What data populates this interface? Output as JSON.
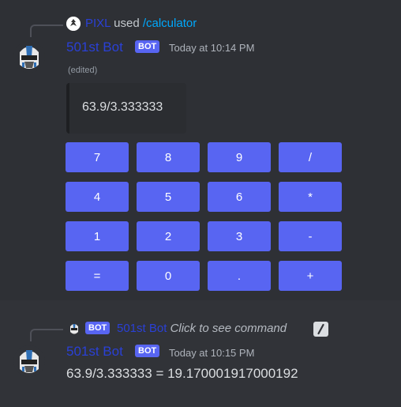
{
  "message1": {
    "reference": {
      "user": "PIXL",
      "mid_text": "used",
      "command": "/calculator"
    },
    "author": "501st Bot",
    "bot_tag": "BOT",
    "timestamp": "Today at 10:14 PM",
    "edited": "(edited)",
    "embed_text": "63.9/3.333333",
    "keypad": [
      [
        "7",
        "8",
        "9",
        "/"
      ],
      [
        "4",
        "5",
        "6",
        "*"
      ],
      [
        "1",
        "2",
        "3",
        "-"
      ],
      [
        "=",
        "0",
        ".",
        "+"
      ]
    ]
  },
  "message2": {
    "reference": {
      "bot_tag": "BOT",
      "user": "501st Bot",
      "hint": "Click to see command"
    },
    "author": "501st Bot",
    "bot_tag": "BOT",
    "timestamp": "Today at 10:15 PM",
    "content": "63.9/3.333333 = 19.170001917000192"
  },
  "colors": {
    "blurple": "#5865f2",
    "username": "#2a40d6",
    "link": "#00a8fc"
  }
}
